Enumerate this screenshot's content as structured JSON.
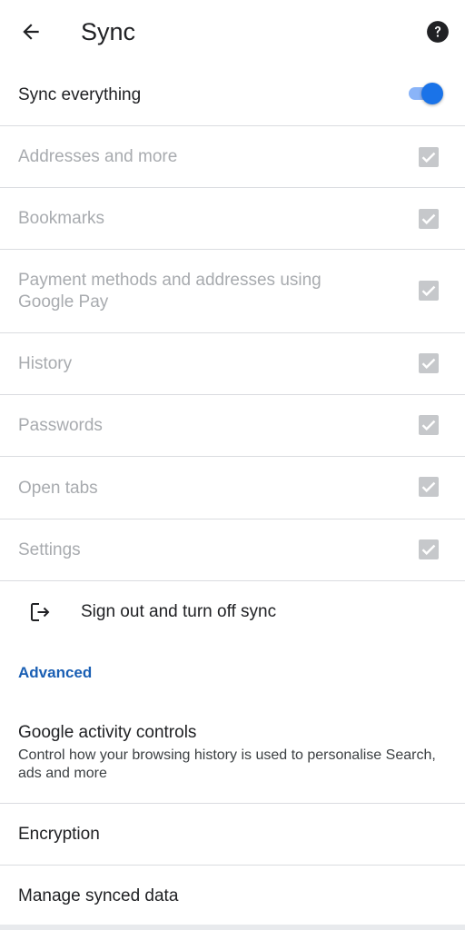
{
  "header": {
    "title": "Sync",
    "back_icon": "arrow-back-icon",
    "help_icon": "help-circle-icon"
  },
  "sync_everything": {
    "label": "Sync everything",
    "enabled": true
  },
  "sync_items": [
    {
      "label": "Addresses and more",
      "checked": true
    },
    {
      "label": "Bookmarks",
      "checked": true
    },
    {
      "label": "Payment methods and addresses using Google Pay",
      "checked": true
    },
    {
      "label": "History",
      "checked": true
    },
    {
      "label": "Passwords",
      "checked": true
    },
    {
      "label": "Open tabs",
      "checked": true
    },
    {
      "label": "Settings",
      "checked": true
    }
  ],
  "sign_out": {
    "label": "Sign out and turn off sync",
    "icon": "sign-out-icon"
  },
  "advanced": {
    "header": "Advanced",
    "activity_controls": {
      "title": "Google activity controls",
      "description": "Control how your browsing history is used to personalise Search, ads and more"
    },
    "encryption": "Encryption",
    "manage_synced_data": "Manage synced data"
  },
  "colors": {
    "accent": "#1a73e8",
    "accent_light": "#8ab4f8",
    "section_header": "#1a5fb4",
    "disabled_text": "#a8abaf",
    "checkbox_disabled": "#c6c8cb",
    "divider": "#dadce0"
  }
}
